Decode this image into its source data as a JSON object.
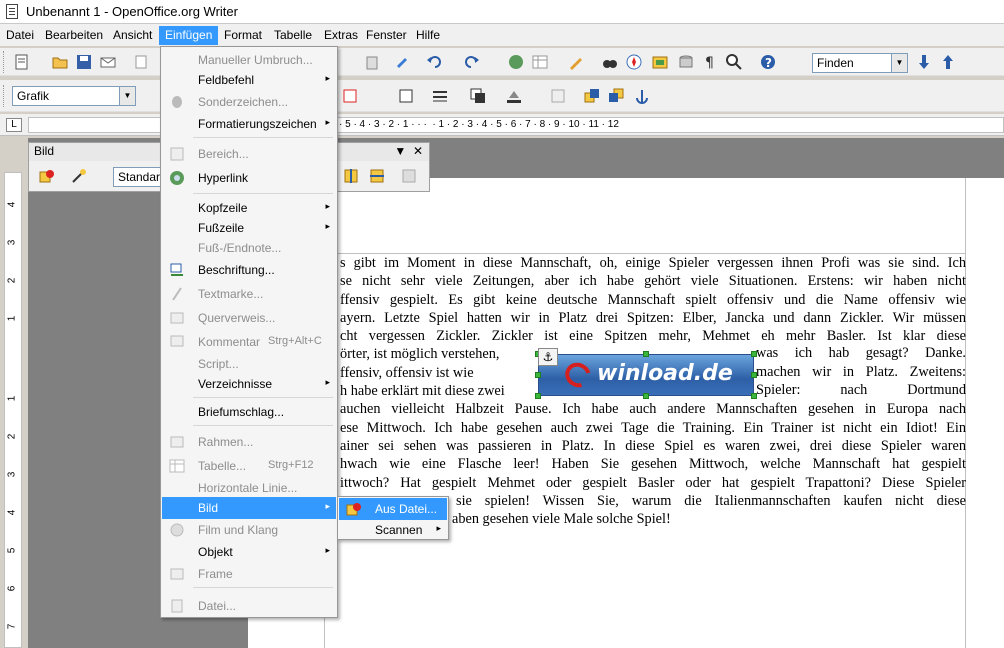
{
  "window": {
    "title": "Unbenannt 1 - OpenOffice.org Writer"
  },
  "menubar": {
    "items": [
      "Datei",
      "Bearbeiten",
      "Ansicht",
      "Einfügen",
      "Format",
      "Tabelle",
      "Extras",
      "Fenster",
      "Hilfe"
    ],
    "active": "Einfügen"
  },
  "toolbar": {
    "find_placeholder": "Finden",
    "frame_style": "Grafik"
  },
  "ruler": {
    "horizontal_text": "· 5 · 4 · 3 · 2 · 1 · · ·  · 1 · 2 · 3 · 4 · 5 · 6 · 7 · 8 · 9 · 10 · 11 · 12",
    "vertical_ticks": [
      "4",
      "3",
      "2",
      "1",
      "1",
      "2",
      "3",
      "4",
      "5",
      "6",
      "7"
    ]
  },
  "bild_toolbar": {
    "title": "Bild",
    "mode_value": "Standard"
  },
  "insert_menu": {
    "items": [
      {
        "label": "Manueller Umbruch...",
        "disabled": true
      },
      {
        "label": "Feldbefehl",
        "submenu": true
      },
      {
        "label": "Sonderzeichen...",
        "disabled": true,
        "icon": "special-char-icon"
      },
      {
        "label": "Formatierungszeichen",
        "submenu": true
      },
      {
        "label": "Bereich...",
        "disabled": true,
        "icon": "section-icon"
      },
      {
        "label": "Hyperlink",
        "icon": "hyperlink-icon"
      },
      {
        "label": "Kopfzeile",
        "submenu": true
      },
      {
        "label": "Fußzeile",
        "submenu": true
      },
      {
        "label": "Fuß-/Endnote...",
        "disabled": true
      },
      {
        "label": "Beschriftung...",
        "icon": "caption-icon"
      },
      {
        "label": "Textmarke...",
        "disabled": true,
        "icon": "bookmark-icon"
      },
      {
        "label": "Querverweis...",
        "disabled": true,
        "icon": "cross-reference-icon"
      },
      {
        "label": "Kommentar",
        "shortcut": "Strg+Alt+C",
        "disabled": true,
        "icon": "comment-icon"
      },
      {
        "label": "Script...",
        "disabled": true
      },
      {
        "label": "Verzeichnisse",
        "submenu": true
      },
      {
        "label": "Briefumschlag..."
      },
      {
        "label": "Rahmen...",
        "disabled": true,
        "icon": "frame-icon"
      },
      {
        "label": "Tabelle...",
        "shortcut": "Strg+F12",
        "disabled": true,
        "icon": "table-icon"
      },
      {
        "label": "Horizontale Linie...",
        "disabled": true
      },
      {
        "label": "Bild",
        "submenu": true,
        "highlighted": true
      },
      {
        "label": "Film und Klang",
        "disabled": true,
        "icon": "media-icon"
      },
      {
        "label": "Objekt",
        "submenu": true
      },
      {
        "label": "Frame",
        "disabled": true,
        "icon": "floating-frame-icon"
      },
      {
        "label": "Datei...",
        "disabled": true,
        "icon": "file-icon"
      }
    ]
  },
  "image_submenu": {
    "items": [
      {
        "label": "Aus Datei...",
        "highlighted": true,
        "icon": "image-from-file-icon"
      },
      {
        "label": "Scannen",
        "submenu": true
      }
    ]
  },
  "document": {
    "lines": [
      "s gibt im Moment in diese Mannschaft, oh, einige Spieler vergessen ihnen Profi was sie sind. Ich",
      "se nicht sehr viele Zeitungen, aber ich habe gehört viele Situationen. Erstens: wir haben nicht",
      "ffensiv gespielt. Es gibt keine deutsche Mannschaft spielt offensiv und die Name offensiv wie",
      "ayern. Letzte Spiel hatten wir in Platz drei Spitzen: Elber, Jancka und dann Zickler. Wir müssen",
      "cht vergessen Zickler. Zickler ist eine Spitzen mehr, Mehmet eh mehr Basler. Ist klar diese",
      "örter, ist möglich verstehen,",
      "ffensiv, offensiv ist wie",
      "h habe erklärt mit diese zwei",
      "auchen vielleicht Halbzeit Pause. Ich habe auch andere Mannschaften gesehen in Europa nach",
      "ese Mittwoch. Ich habe gesehen auch zwei Tage die Training. Ein Trainer ist nicht ein Idiot! Ein",
      "ainer sei sehen was passieren in Platz. In diese Spiel es waren zwei, drei diese Spieler waren",
      "hwach wie eine Flasche leer! Haben Sie gesehen Mittwoch, welche Mannschaft hat gespielt",
      "ittwoch? Hat gespielt Mehmet oder gespielt Basler oder hat gespielt Trapattoni? Diese Spieler",
      "sie spielen! Wissen Sie, warum die Italienmannschaften kaufen nicht diese",
      "aben gesehen viele Male solche Spiel!"
    ],
    "right_fragments": [
      "was ich hab gesagt? Danke.",
      "machen wir in Platz. Zweitens:",
      "Spieler:   nach   Dortmund"
    ],
    "inserted_image_text": "winload.de"
  }
}
